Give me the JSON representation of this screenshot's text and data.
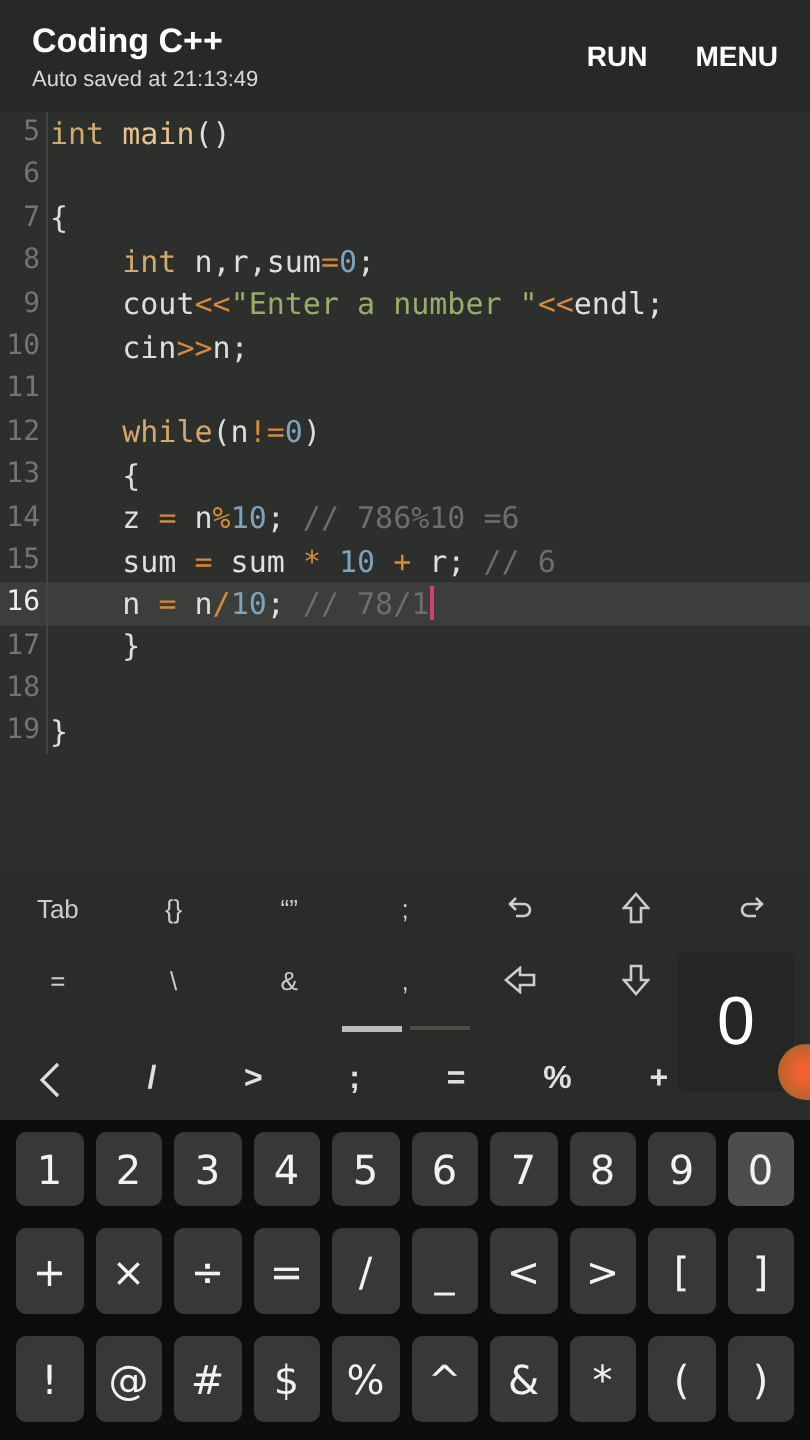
{
  "app_bar": {
    "title": "Coding C++",
    "subtitle": "Auto saved at 21:13:49",
    "actions": [
      "RUN",
      "MENU"
    ]
  },
  "editor": {
    "lines": [
      {
        "number": "5",
        "current": false,
        "tokens": [
          {
            "kind": "keyword",
            "text": "int"
          },
          {
            "kind": "function",
            "text": " main"
          },
          {
            "kind": "plain",
            "text": "()"
          }
        ]
      },
      {
        "number": "6",
        "current": false
      },
      {
        "number": "7",
        "current": false,
        "tokens": [
          {
            "kind": "plain",
            "text": "{"
          }
        ]
      },
      {
        "number": "8",
        "current": false,
        "tokens": [
          {
            "kind": "keyword",
            "text": "    int"
          },
          {
            "kind": "plain",
            "text": " n,r,sum"
          },
          {
            "kind": "operator",
            "text": "="
          },
          {
            "kind": "number",
            "text": "0"
          },
          {
            "kind": "plain",
            "text": ";"
          }
        ]
      },
      {
        "number": "9",
        "current": false,
        "tokens": [
          {
            "kind": "plain",
            "text": "    cout"
          },
          {
            "kind": "operator",
            "text": "<<"
          },
          {
            "kind": "string",
            "text": "\"Enter a number \""
          },
          {
            "kind": "operator",
            "text": "<<"
          },
          {
            "kind": "plain",
            "text": "endl;"
          }
        ]
      },
      {
        "number": "10",
        "current": false,
        "tokens": [
          {
            "kind": "plain",
            "text": "    cin"
          },
          {
            "kind": "operator",
            "text": ">>"
          },
          {
            "kind": "plain",
            "text": "n;"
          }
        ]
      },
      {
        "number": "11",
        "current": false
      },
      {
        "number": "12",
        "current": false,
        "tokens": [
          {
            "kind": "keyword",
            "text": "    while"
          },
          {
            "kind": "plain",
            "text": "(n"
          },
          {
            "kind": "operator",
            "text": "!="
          },
          {
            "kind": "number",
            "text": "0"
          },
          {
            "kind": "plain",
            "text": ")"
          }
        ]
      },
      {
        "number": "13",
        "current": false,
        "tokens": [
          {
            "kind": "plain",
            "text": "    {"
          }
        ]
      },
      {
        "number": "14",
        "current": false,
        "tokens": [
          {
            "kind": "plain",
            "text": "    z "
          },
          {
            "kind": "operator",
            "text": "="
          },
          {
            "kind": "plain",
            "text": " n"
          },
          {
            "kind": "operator",
            "text": "%"
          },
          {
            "kind": "number",
            "text": "10"
          },
          {
            "kind": "plain",
            "text": ";"
          },
          {
            "kind": "comment",
            "text": " // 786%10 =6"
          }
        ]
      },
      {
        "number": "15",
        "current": false,
        "tokens": [
          {
            "kind": "plain",
            "text": "    sum "
          },
          {
            "kind": "operator",
            "text": "="
          },
          {
            "kind": "plain",
            "text": " sum "
          },
          {
            "kind": "operator",
            "text": "*"
          },
          {
            "kind": "number",
            "text": " 10"
          },
          {
            "kind": "operator",
            "text": " +"
          },
          {
            "kind": "plain",
            "text": " r;"
          },
          {
            "kind": "comment",
            "text": " // 6"
          }
        ]
      },
      {
        "number": "16",
        "current": true,
        "tokens": [
          {
            "kind": "plain",
            "text": "    n "
          },
          {
            "kind": "operator",
            "text": "="
          },
          {
            "kind": "plain",
            "text": " n"
          },
          {
            "kind": "operator",
            "text": "/"
          },
          {
            "kind": "number",
            "text": "10"
          },
          {
            "kind": "plain",
            "text": ";"
          },
          {
            "kind": "comment",
            "text": " // 78/1"
          }
        ]
      },
      {
        "number": "17",
        "current": false,
        "tokens": [
          {
            "kind": "plain",
            "text": "    }"
          }
        ]
      },
      {
        "number": "18",
        "current": false
      },
      {
        "number": "19",
        "current": false,
        "tokens": [
          {
            "kind": "plain",
            "text": "}"
          }
        ]
      }
    ]
  },
  "extra_keys": {
    "rows": [
      [
        {
          "kind": "text",
          "label": "Tab"
        },
        {
          "kind": "text",
          "label": "{}"
        },
        {
          "kind": "text",
          "label": "“”"
        },
        {
          "kind": "text",
          "label": ";"
        },
        {
          "kind": "undo"
        },
        {
          "kind": "up"
        },
        {
          "kind": "redo"
        }
      ],
      [
        {
          "kind": "text",
          "label": "="
        },
        {
          "kind": "text",
          "label": "\\"
        },
        {
          "kind": "text",
          "label": "&"
        },
        {
          "kind": "text",
          "label": ","
        },
        {
          "kind": "left"
        },
        {
          "kind": "down"
        }
      ]
    ],
    "pages": [
      {
        "selected": true
      },
      {
        "selected": false
      }
    ]
  },
  "symbol_strip": [
    {
      "kind": "chevron"
    },
    {
      "kind": "text",
      "label": "/"
    },
    {
      "kind": "text",
      "label": ">"
    },
    {
      "kind": "text",
      "label": ";"
    },
    {
      "kind": "text",
      "label": "="
    },
    {
      "kind": "text",
      "label": "%"
    },
    {
      "kind": "text",
      "label": "+"
    }
  ],
  "key_preview": {
    "label": "0"
  },
  "keyboard": {
    "rows": [
      [
        {
          "label": "1",
          "pressed": false
        },
        {
          "label": "2",
          "pressed": false
        },
        {
          "label": "3",
          "pressed": false
        },
        {
          "label": "4",
          "pressed": false
        },
        {
          "label": "5",
          "pressed": false
        },
        {
          "label": "6",
          "pressed": false
        },
        {
          "label": "7",
          "pressed": false
        },
        {
          "label": "8",
          "pressed": false
        },
        {
          "label": "9",
          "pressed": false
        },
        {
          "label": "0",
          "pressed": true
        }
      ],
      [
        {
          "label": "+",
          "pressed": false
        },
        {
          "label": "×",
          "pressed": false
        },
        {
          "label": "÷",
          "pressed": false
        },
        {
          "label": "=",
          "pressed": false
        },
        {
          "label": "/",
          "pressed": false
        },
        {
          "label": "_",
          "pressed": false
        },
        {
          "label": "<",
          "pressed": false
        },
        {
          "label": ">",
          "pressed": false
        },
        {
          "label": "[",
          "pressed": false
        },
        {
          "label": "]",
          "pressed": false
        }
      ],
      [
        {
          "label": "!",
          "pressed": false
        },
        {
          "label": "@",
          "pressed": false
        },
        {
          "label": "#",
          "pressed": false
        },
        {
          "label": "$",
          "pressed": false
        },
        {
          "label": "%",
          "pressed": false
        },
        {
          "label": "^",
          "pressed": false
        },
        {
          "label": "&",
          "pressed": false
        },
        {
          "label": "*",
          "pressed": false
        },
        {
          "label": "(",
          "pressed": false
        },
        {
          "label": ")",
          "pressed": false
        }
      ]
    ]
  }
}
